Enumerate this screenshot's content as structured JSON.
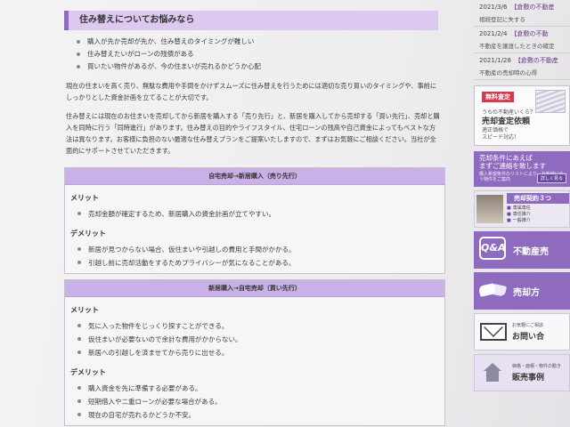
{
  "main": {
    "section_title": "住み替えについてお悩みなら",
    "concerns": [
      "購入が先か売却が先か、住み替えのタイミングが難しい",
      "住み替えたいがローンの残債がある",
      "買いたい物件があるが、今の住まいが売れるかどうか心配"
    ],
    "para1": "現在の住まいを高く売り、無駄な費用や手間をかけずスムーズに住み替えを行うためには適切な売り買いのタイミングや、事前にしっかりとした資金計画を立てることが大切です。",
    "para2": "住み替えには現在のお住まいを売却してから新居を購入する「売り先行」と、新居を購入してから売却する「買い先行」、売却と購入を同時に行う「同時進行」があります。住み替えの目的やライフスタイル、住宅ローンの残高や自己資金によってもベストな方法は異なります。お客様に負担のない最適な住み替えプランをご提案いたしますので、まずはお気軽にご相談ください。当社が全面的にサポートさせていただきます。",
    "box1": {
      "title": "自宅売却→新居購入（売り先行）",
      "merit_label": "メリット",
      "merits": [
        "売却金額が確定するため、新居購入の資金計画が立てやすい。"
      ],
      "demerit_label": "デメリット",
      "demerits": [
        "新居が見つからない場合、仮住まいや引越しの費用と手間がかかる。",
        "引越し前に売却活動をするためプライバシーが気になることがある。"
      ]
    },
    "box2": {
      "title": "新居購入→自宅売却（買い先行）",
      "merit_label": "メリット",
      "merits": [
        "気に入った物件をじっくり探すことができる。",
        "仮住まいが必要ないので余計な費用がかからない。",
        "新居への引越しを済ませてから売りに出せる。"
      ],
      "demerit_label": "デメリット",
      "demerits": [
        "購入資金を先に準備する必要がある。",
        "短期借入や二重ローンが必要な場合がある。",
        "現在の自宅が売れるかどうか不安。"
      ]
    }
  },
  "sidebar": {
    "news": [
      {
        "date": "2021/3/6",
        "link": "【倉敷の不動産",
        "line2": "相続登記に失する"
      },
      {
        "date": "2021/2/4",
        "link": "【倉敷の不動",
        "line2": "不動産を譲渡したときの確定"
      },
      {
        "date": "2021/1/28",
        "link": "【倉敷の不動産",
        "line2": "不動産の売却時の心得"
      }
    ],
    "appraisal": {
      "tag": "無料査定",
      "line1": "うちの不動産いくら？",
      "line2": "売却査定依頼",
      "line3": "適正価格で",
      "line4": "スピード対応！"
    },
    "condition": {
      "line1": "売却条件にあえば",
      "line2": "まずご連絡を致します",
      "line3": "購入希望条件のリストにより、お客様に合う物件をご案内",
      "button": "詳しく見る"
    },
    "contract": {
      "title": "売却契約３つ",
      "sub": "売却契約の種類は３つ",
      "items": [
        "専属専任",
        "専任媒介",
        "一般媒介"
      ]
    },
    "tiles": {
      "qa_icon_text": "Q&A",
      "qa_text": "不動産売",
      "sell_text": "売却方",
      "contact_small": "お気軽にご相談",
      "contact_text": "お問い合",
      "case_small": "価格・面積・物件の動き",
      "case_text": "販売事例"
    }
  }
}
